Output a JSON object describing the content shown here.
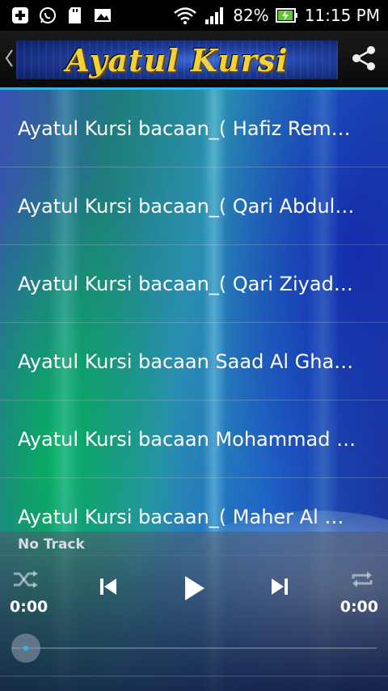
{
  "status_bar": {
    "battery": "82%",
    "time": "11:15 PM",
    "icons": [
      "add-icon",
      "whatsapp-icon",
      "sd-card-icon",
      "image-icon",
      "wifi-icon",
      "signal-icon",
      "battery-icon"
    ]
  },
  "action_bar": {
    "banner_title": "Ayatul Kursi",
    "icons": [
      "back-chevron-icon",
      "share-icon"
    ]
  },
  "tracks": [
    "Ayatul Kursi bacaan_( Hafiz Remadhan )",
    "Ayatul Kursi bacaan_( Qari Abdul Basit )",
    "Ayatul Kursi bacaan_( Qari Ziyad Patel )",
    "Ayatul Kursi bacaan Saad Al Ghamdi",
    "Ayatul Kursi bacaan Mohammad Ayyub",
    "Ayatul Kursi bacaan_( Maher Al Muaiqly )"
  ],
  "player": {
    "track_label": "No Track",
    "elapsed": "0:00",
    "duration": "0:00",
    "progress": 0,
    "icons": [
      "shuffle-icon",
      "previous-icon",
      "play-icon",
      "next-icon",
      "repeat-icon"
    ]
  },
  "colors": {
    "accent": "#33b5e5",
    "banner_text": "#f2d13a",
    "banner_bg": "#1d3c9a"
  }
}
